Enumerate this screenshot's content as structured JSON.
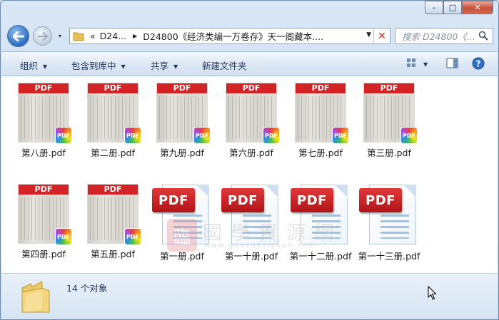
{
  "window": {
    "caption": {
      "minimize": "–",
      "maximize": "□",
      "close": "✕"
    }
  },
  "address": {
    "overflow": "«",
    "segments": [
      "D24...",
      "D24800《经济类编一万卷存》天一阁藏本...."
    ],
    "history_arrow": "▾"
  },
  "search": {
    "placeholder": "搜索 D24800《..."
  },
  "toolbar": {
    "organize": "组织",
    "include_library": "包含到库中",
    "share": "共享",
    "new_folder": "新建文件夹"
  },
  "files": [
    {
      "name": "第八册.pdf",
      "kind": "thumb"
    },
    {
      "name": "第二册.pdf",
      "kind": "thumb"
    },
    {
      "name": "第九册.pdf",
      "kind": "thumb"
    },
    {
      "name": "第六册.pdf",
      "kind": "thumb"
    },
    {
      "name": "第七册.pdf",
      "kind": "thumb"
    },
    {
      "name": "第三册.pdf",
      "kind": "thumb"
    },
    {
      "name": "第四册.pdf",
      "kind": "thumb"
    },
    {
      "name": "第五册.pdf",
      "kind": "thumb"
    },
    {
      "name": "第一册.pdf",
      "kind": "icon"
    },
    {
      "name": "第一十册.pdf",
      "kind": "icon"
    },
    {
      "name": "第一十二册.pdf",
      "kind": "icon"
    },
    {
      "name": "第一十三册.pdf",
      "kind": "icon"
    }
  ],
  "thumb_band": "PDF",
  "icon_tag": "PDF",
  "badge_text": "PDF",
  "watermark": {
    "seal": "臨",
    "title": "國學資源網",
    "url": "www.guoxueziyuan.com"
  },
  "status": {
    "count": "14 个对象"
  },
  "colors": {
    "pdf_red": "#d32327",
    "toolbar_text": "#1e395b",
    "close_red": "#c8503a"
  }
}
